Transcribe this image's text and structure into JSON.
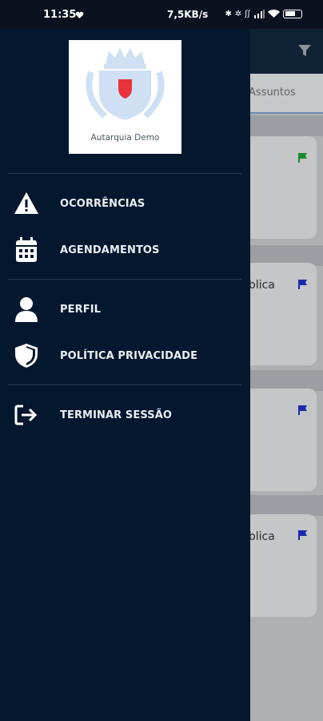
{
  "status_bar": {
    "time": "11:35",
    "network_speed": "7,5KB/s",
    "icons": [
      "heart-icon",
      "bluetooth-icon",
      "vibrate-icon",
      "nfc-icon",
      "signal-icon",
      "wifi-icon",
      "battery-icon"
    ]
  },
  "background": {
    "tab_label": "Assuntos",
    "card_texts": [
      "ública",
      "ública"
    ],
    "flags": [
      {
        "color": "#1a8a2a",
        "icon": "flag-icon"
      },
      {
        "color": "#1a2aa8",
        "icon": "flag-icon"
      },
      {
        "color": "#1a2aa8",
        "icon": "flag-icon"
      },
      {
        "color": "#1a2aa8",
        "icon": "flag-icon"
      }
    ],
    "filter_icon": "filter-icon"
  },
  "drawer": {
    "logo_text": "Autarquia Demo",
    "menu": [
      {
        "label": "OCORRÊNCIAS",
        "icon": "warning-icon"
      },
      {
        "label": "AGENDAMENTOS",
        "icon": "calendar-icon"
      },
      {
        "label": "PERFIL",
        "icon": "user-icon"
      },
      {
        "label": "POLÍTICA PRIVACIDADE",
        "icon": "shield-icon"
      },
      {
        "label": "TERMINAR SESSÃO",
        "icon": "logout-icon"
      }
    ]
  },
  "colors": {
    "drawer_bg": "#03172f",
    "app_bar": "#0f2135",
    "logo_red": "#e8323c",
    "logo_blue": "#cfe0f4"
  }
}
